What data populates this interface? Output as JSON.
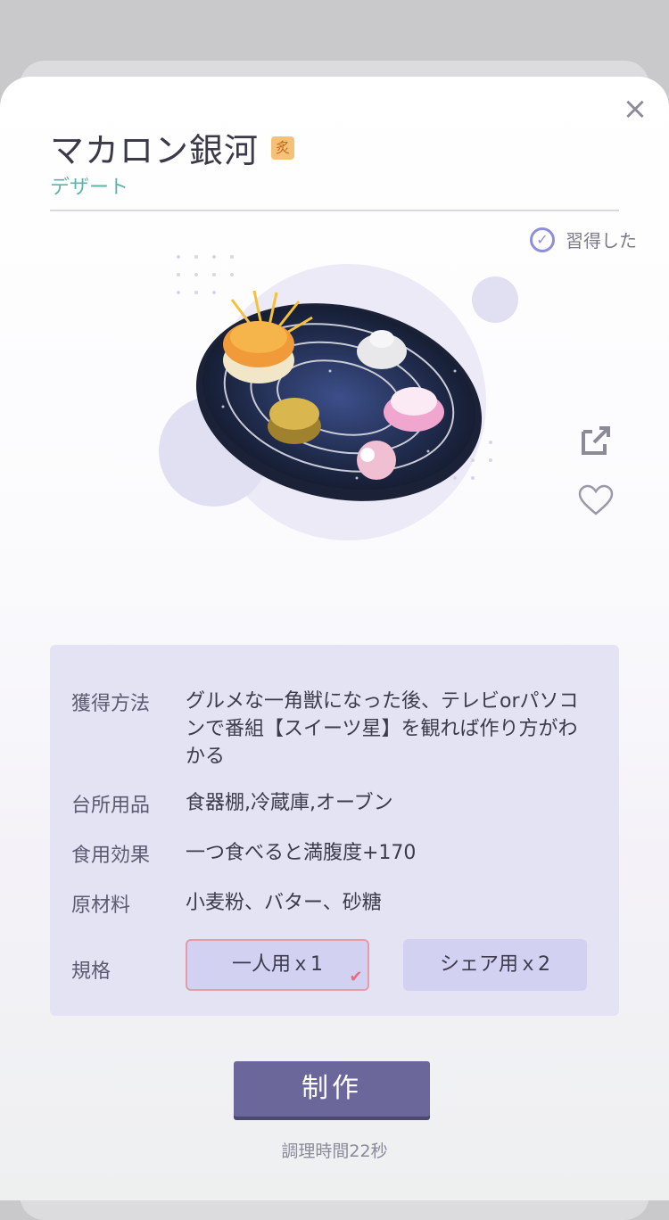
{
  "header": {
    "title": "マカロン銀河",
    "badge": "炙",
    "category": "デザート",
    "learned_label": "習得した"
  },
  "info": {
    "rows": [
      {
        "label": "獲得方法",
        "value": "グルメな一角獣になった後、テレビorパソコンで番組【スイーツ星】を観れば作り方がわかる"
      },
      {
        "label": "台所用品",
        "value": "食器棚,冷蔵庫,オーブン"
      },
      {
        "label": "食用効果",
        "value": "一つ食べると満腹度+170"
      },
      {
        "label": "原材料",
        "value": "小麦粉、バター、砂糖"
      }
    ],
    "spec_label": "規格",
    "spec_options": [
      "一人用ｘ1",
      "シェア用ｘ2"
    ],
    "spec_selected": "一人用ｘ1"
  },
  "actions": {
    "make_label": "制作",
    "cook_time": "調理時間22秒"
  },
  "icons": {
    "close": "close-icon",
    "learned": "check-circle-icon",
    "share": "share-icon",
    "favorite": "heart-icon"
  },
  "colors": {
    "accent": "#6b679a",
    "category": "#5fb3a6",
    "panel": "#e4e3f3",
    "selected_border": "#e79aa8"
  }
}
